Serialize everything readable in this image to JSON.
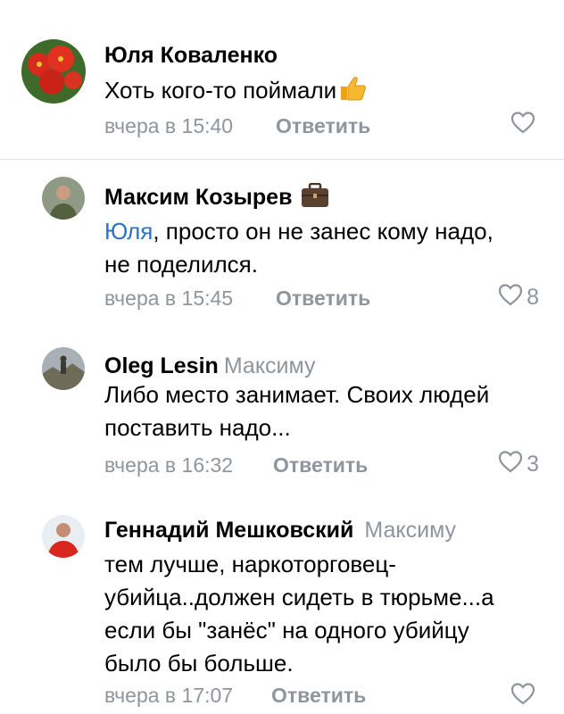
{
  "comments": [
    {
      "author": "Юля Коваленко",
      "reply_to": "",
      "mention": "",
      "lines": [
        "Хоть кого-то поймали"
      ],
      "emoji": "thumbs-up-icon",
      "time": "вчера в 15:40",
      "reply_label": "Ответить",
      "likes": ""
    },
    {
      "author": "Максим Козырев",
      "reply_to": "",
      "mention": "Юля",
      "lines": [
        ", просто он не занес кому надо,",
        "не поделился."
      ],
      "emoji": "briefcase-icon",
      "time": "вчера в 15:45",
      "reply_label": "Ответить",
      "likes": "8"
    },
    {
      "author": "Oleg Lesin",
      "reply_to": "Максиму",
      "mention": "",
      "lines": [
        "Либо место занимает. Своих людей",
        "поставить надо..."
      ],
      "emoji": "",
      "time": "вчера в 16:32",
      "reply_label": "Ответить",
      "likes": "3"
    },
    {
      "author": "Геннадий Мешковский",
      "reply_to": "Максиму",
      "mention": "",
      "lines": [
        "тем лучше, наркоторговец-",
        "убийца..должен сидеть в тюрьме...а",
        "если бы \"занёс\" на одного убийцу",
        "было бы больше."
      ],
      "emoji": "",
      "time": "вчера в 17:07",
      "reply_label": "Ответить",
      "likes": ""
    }
  ],
  "colors": {
    "meta_gray": "#8e959d",
    "mention_blue": "#2a73c4",
    "divider": "#dcdfe3"
  }
}
